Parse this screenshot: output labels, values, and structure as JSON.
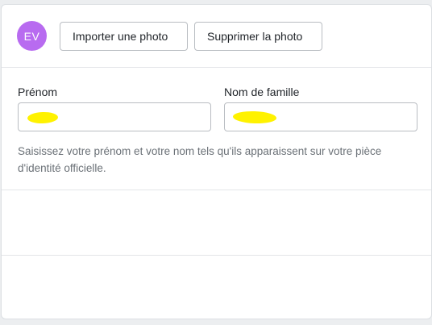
{
  "photo": {
    "avatar_initials": "EV",
    "avatar_color": "#b86bf0",
    "import_label": "Importer une photo",
    "delete_label": "Supprimer la photo"
  },
  "name_form": {
    "first_name_label": "Prénom",
    "last_name_label": "Nom de famille",
    "first_name_value": "",
    "last_name_value": "",
    "help_text": "Saisissez votre prénom et votre nom tels qu'ils apparaissent sur votre pièce d'identité officielle.",
    "redaction_color": "#fff200"
  }
}
